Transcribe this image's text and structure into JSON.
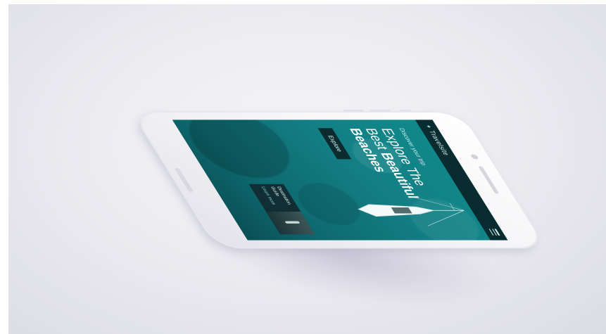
{
  "app": {
    "brand": "Travelsite",
    "kicker": "Discover your trip",
    "headline_light": "Explore The Best",
    "headline_bold": "Beautiful Beaches",
    "cta_label": "Explore",
    "card": {
      "title": "Destination Guide",
      "link": "Learn more"
    }
  },
  "icons": {
    "logo": "compass-icon",
    "menu": "hamburger-menu-icon"
  },
  "colors": {
    "water": "#0f8a8a",
    "topbar": "#082428",
    "button": "#0b2b2f",
    "phone_body": "#f2f2f5",
    "background": "#ececf1"
  }
}
